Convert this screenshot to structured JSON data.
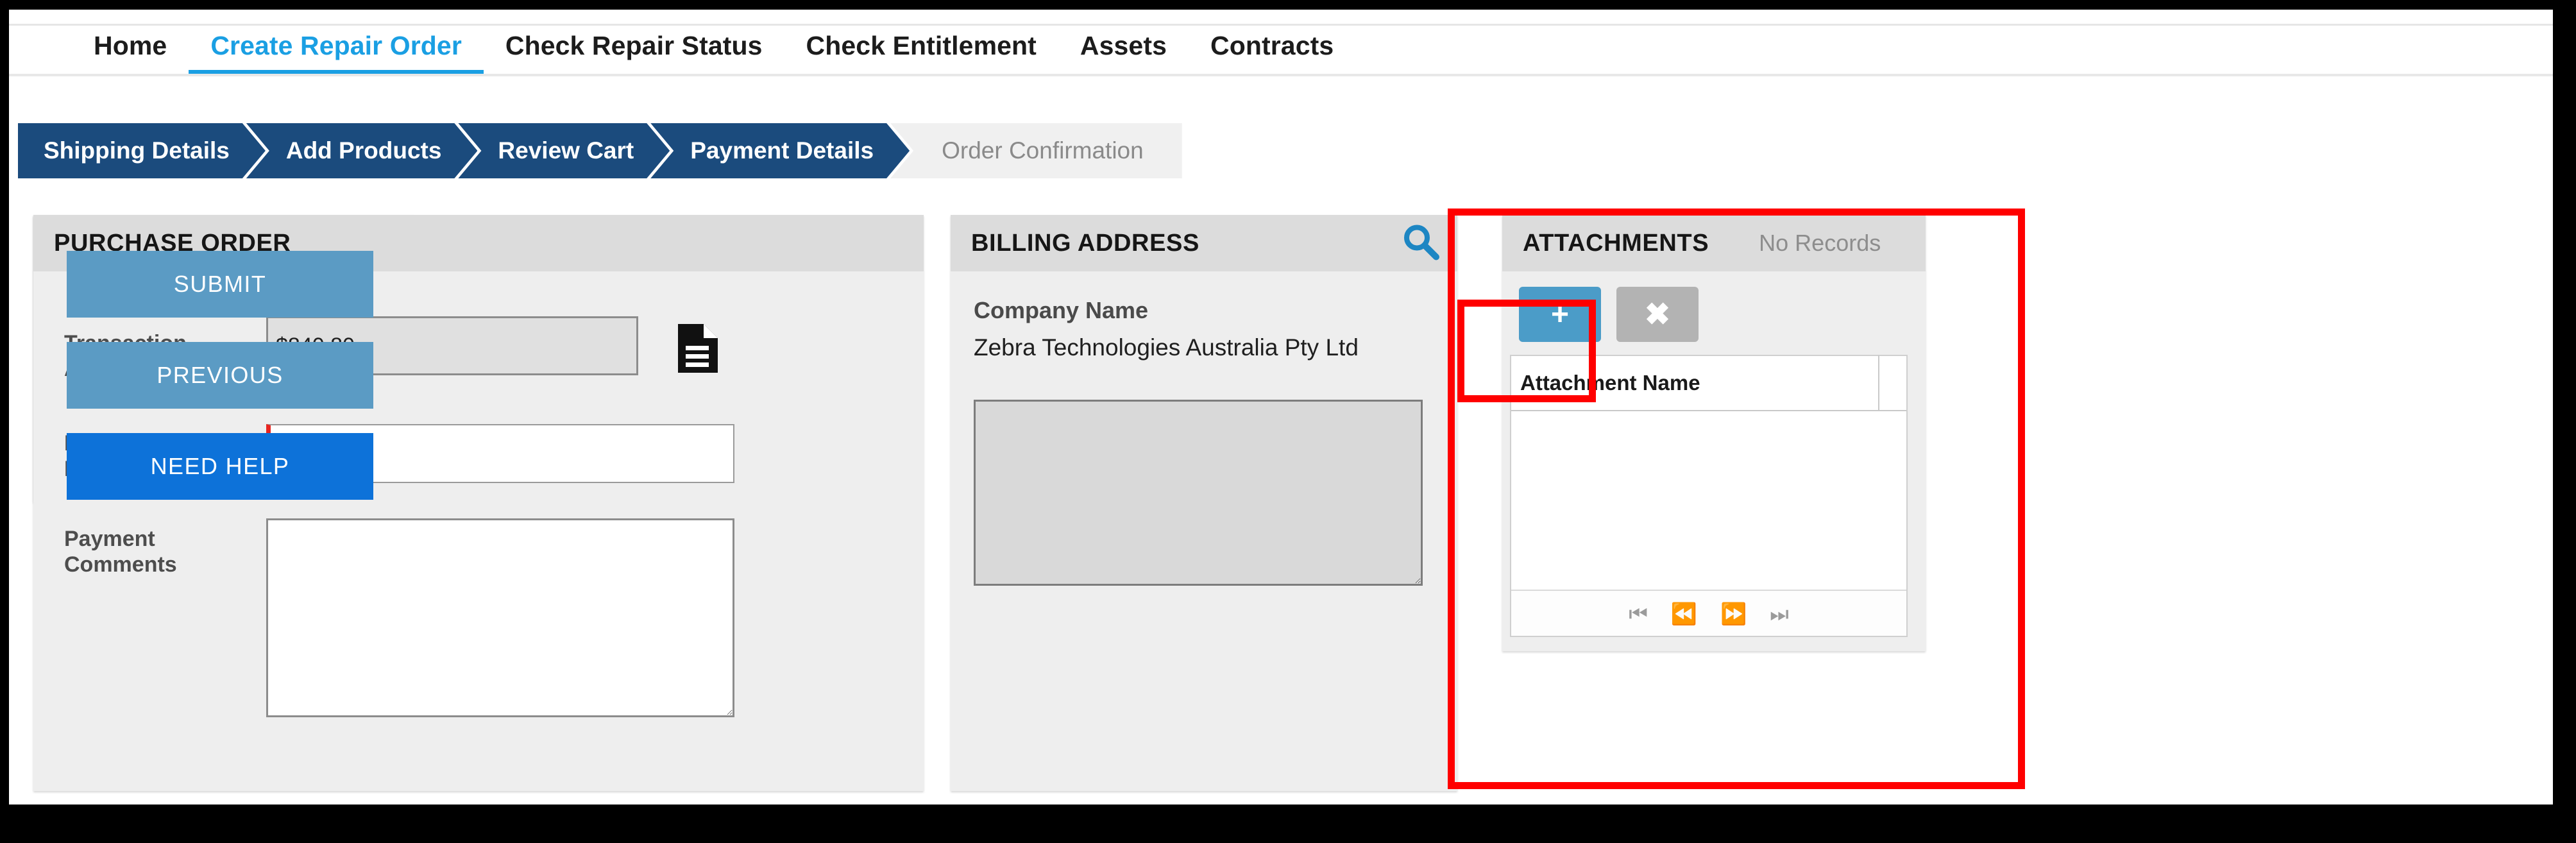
{
  "nav": {
    "items": [
      {
        "label": "Home",
        "active": false
      },
      {
        "label": "Create Repair Order",
        "active": true
      },
      {
        "label": "Check Repair Status",
        "active": false
      },
      {
        "label": "Check Entitlement",
        "active": false
      },
      {
        "label": "Assets",
        "active": false
      },
      {
        "label": "Contracts",
        "active": false
      }
    ]
  },
  "wizard": {
    "steps": [
      {
        "label": "Shipping Details",
        "state": "done"
      },
      {
        "label": "Add Products",
        "state": "done"
      },
      {
        "label": "Review Cart",
        "state": "done"
      },
      {
        "label": "Payment Details",
        "state": "current"
      },
      {
        "label": "Order Confirmation",
        "state": "inactive"
      }
    ]
  },
  "purchase_order": {
    "title": "PURCHASE ORDER",
    "transaction_amount_label": "Transaction Amount",
    "transaction_amount_value": "$840.80",
    "document_icon": "document-icon",
    "po_number_label": "Purchase Order Number",
    "po_number_value": "",
    "po_number_placeholder": "",
    "payment_comments_label": "Payment Comments",
    "payment_comments_value": "",
    "payment_comments_placeholder": ""
  },
  "billing_address": {
    "title": "BILLING ADDRESS",
    "search_icon": "search-icon",
    "company_name_label": "Company Name",
    "company_name_value": "Zebra Technologies Australia Pty Ltd",
    "address_value": "",
    "address_placeholder": ""
  },
  "attachments": {
    "title": "ATTACHMENTS",
    "status": "No Records",
    "add_label": "+",
    "remove_label": "✖",
    "grid": {
      "columns": [
        "Attachment Name"
      ],
      "rows": []
    },
    "pager": [
      {
        "name": "first-page-button",
        "glyph": "⏮"
      },
      {
        "name": "previous-page-button",
        "glyph": "⏪"
      },
      {
        "name": "next-page-button",
        "glyph": "⏩"
      },
      {
        "name": "last-page-button",
        "glyph": "⏭"
      }
    ]
  },
  "actions": {
    "submit_label": "SUBMIT",
    "previous_label": "PREVIOUS",
    "need_help_label": "NEED HELP"
  },
  "colors": {
    "accent_blue": "#1a9fe3",
    "wizard_navy": "#1b4b7d",
    "button_muted": "#5b9bc4",
    "button_primary": "#0d72d9",
    "annotation_red": "#ff0000",
    "required_red": "#e8241f"
  }
}
